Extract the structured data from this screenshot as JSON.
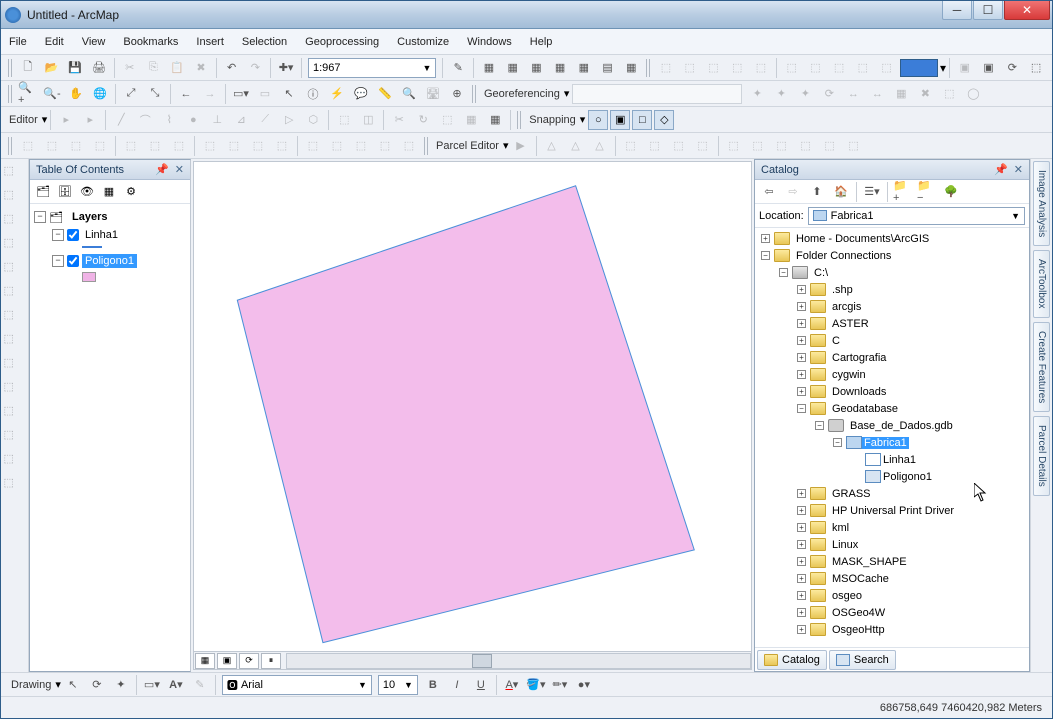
{
  "window": {
    "title": "Untitled - ArcMap"
  },
  "menu": [
    "File",
    "Edit",
    "View",
    "Bookmarks",
    "Insert",
    "Selection",
    "Geoprocessing",
    "Customize",
    "Windows",
    "Help"
  ],
  "scale": "1:967",
  "georef_label": "Georeferencing",
  "editor_label": "Editor",
  "snapping_label": "Snapping",
  "parcel_label": "Parcel Editor",
  "toc": {
    "title": "Table Of Contents",
    "root": "Layers",
    "layers": [
      {
        "name": "Linha1",
        "checked": true,
        "type": "line"
      },
      {
        "name": "Poligono1",
        "checked": true,
        "type": "polygon",
        "selected": true
      }
    ]
  },
  "catalog": {
    "title": "Catalog",
    "location_label": "Location:",
    "location_value": "Fabrica1",
    "tree": {
      "home": "Home - Documents\\ArcGIS",
      "folderconn": "Folder Connections",
      "drive": "C:\\",
      "folders": [
        ".shp",
        "arcgis",
        "ASTER",
        "C",
        "Cartografia",
        "cygwin",
        "Downloads"
      ],
      "geodb_folder": "Geodatabase",
      "gdb": "Base_de_Dados.gdb",
      "fdset": "Fabrica1",
      "fcs": [
        "Linha1",
        "Poligono1"
      ],
      "folders2": [
        "GRASS",
        "HP Universal Print Driver",
        "kml",
        "Linux",
        "MASK_SHAPE",
        "MSOCache",
        "osgeo",
        "OSGeo4W",
        "OsgeoHttp"
      ]
    },
    "tabs": [
      "Catalog",
      "Search"
    ]
  },
  "righttabs": [
    "Image Analysis",
    "ArcToolbox",
    "Create Features",
    "Parcel Details"
  ],
  "drawing": {
    "label": "Drawing",
    "font": "Arial",
    "size": "10"
  },
  "status": "686758,649 7460420,982 Meters"
}
